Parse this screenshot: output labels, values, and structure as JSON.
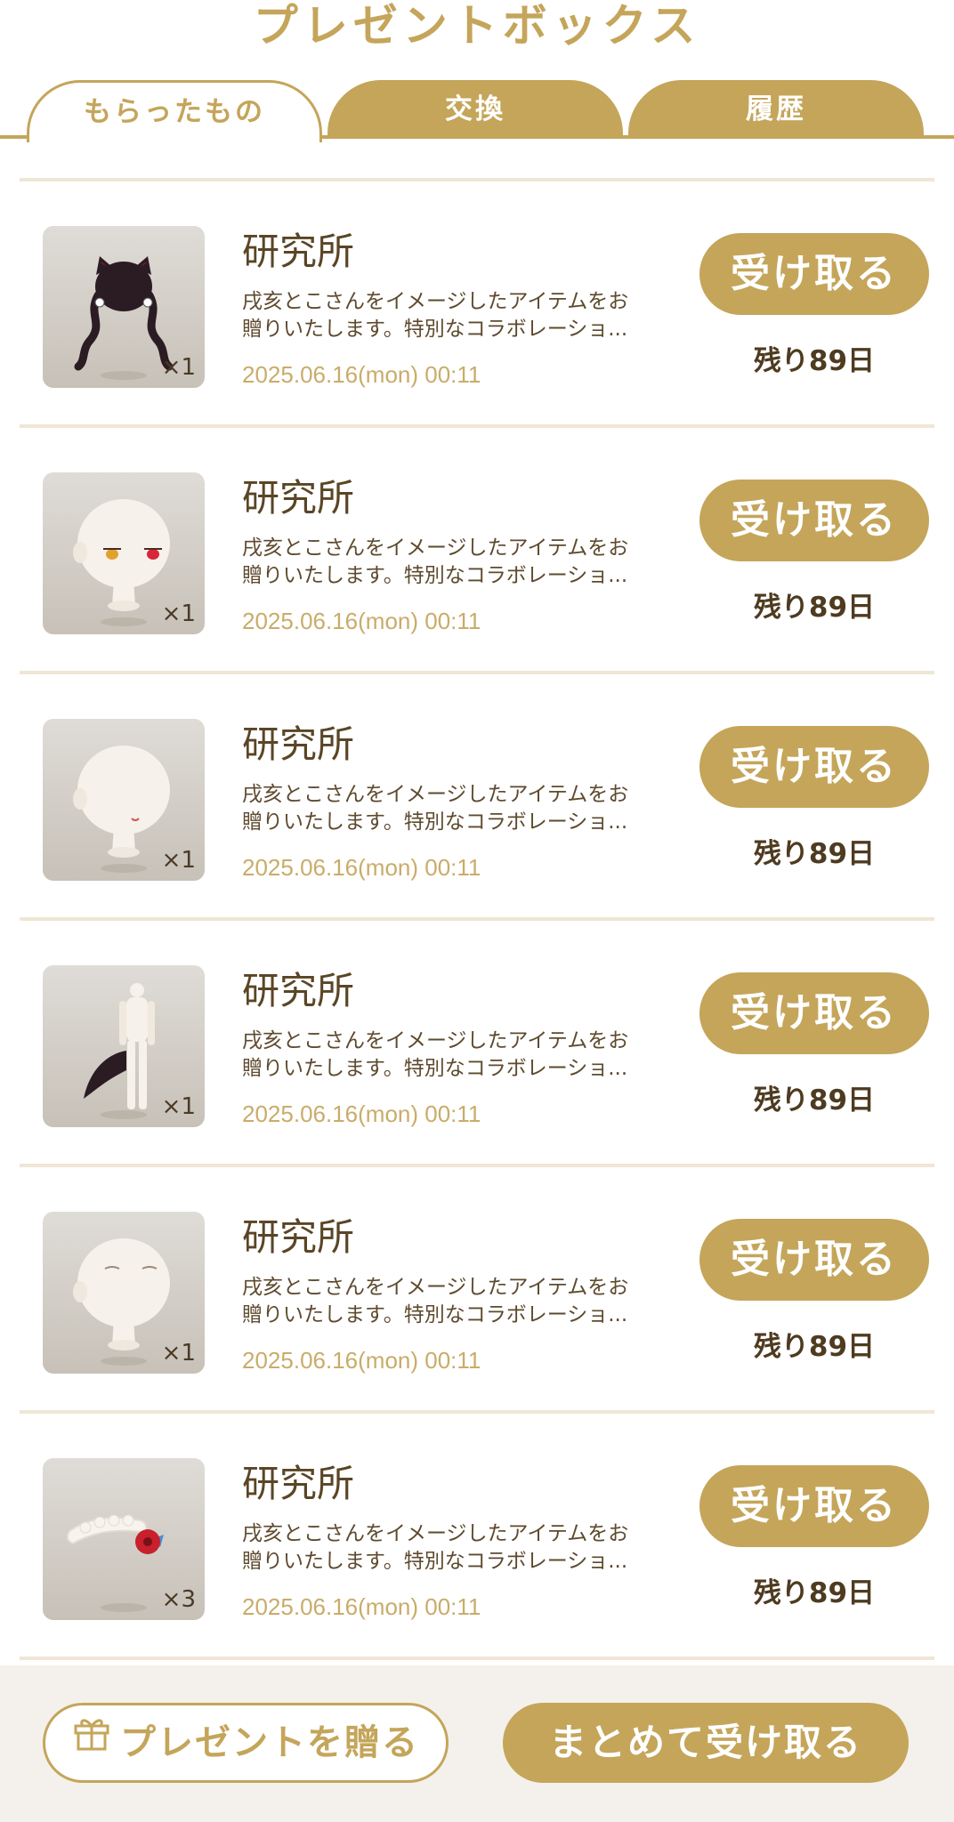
{
  "header": {
    "title": "プレゼントボックス"
  },
  "tabs": [
    {
      "label": "もらったもの",
      "active": true
    },
    {
      "label": "交換",
      "active": false
    },
    {
      "label": "履歴",
      "active": false
    }
  ],
  "items": [
    {
      "title": "研究所",
      "desc_line1": "戌亥とこさんをイメージしたアイテムをお",
      "desc_line2": "贈りいたします。特別なコラボレーショ...",
      "date": "2025.06.16(mon) 00:11",
      "quantity": "×1",
      "button": "受け取る",
      "remain": "残り89日",
      "icon": "hair-icon"
    },
    {
      "title": "研究所",
      "desc_line1": "戌亥とこさんをイメージしたアイテムをお",
      "desc_line2": "贈りいたします。特別なコラボレーショ...",
      "date": "2025.06.16(mon) 00:11",
      "quantity": "×1",
      "button": "受け取る",
      "remain": "残り89日",
      "icon": "eyes-icon"
    },
    {
      "title": "研究所",
      "desc_line1": "戌亥とこさんをイメージしたアイテムをお",
      "desc_line2": "贈りいたします。特別なコラボレーショ...",
      "date": "2025.06.16(mon) 00:11",
      "quantity": "×1",
      "button": "受け取る",
      "remain": "残り89日",
      "icon": "mouth-icon"
    },
    {
      "title": "研究所",
      "desc_line1": "戌亥とこさんをイメージしたアイテムをお",
      "desc_line2": "贈りいたします。特別なコラボレーショ...",
      "date": "2025.06.16(mon) 00:11",
      "quantity": "×1",
      "button": "受け取る",
      "remain": "残り89日",
      "icon": "tail-icon"
    },
    {
      "title": "研究所",
      "desc_line1": "戌亥とこさんをイメージしたアイテムをお",
      "desc_line2": "贈りいたします。特別なコラボレーショ...",
      "date": "2025.06.16(mon) 00:11",
      "quantity": "×1",
      "button": "受け取る",
      "remain": "残り89日",
      "icon": "closed-eyes-icon"
    },
    {
      "title": "研究所",
      "desc_line1": "戌亥とこさんをイメージしたアイテムをお",
      "desc_line2": "贈りいたします。特別なコラボレーショ...",
      "date": "2025.06.16(mon) 00:11",
      "quantity": "×3",
      "button": "受け取る",
      "remain": "残り89日",
      "icon": "hair-accessory-icon"
    }
  ],
  "footer": {
    "gift_label": "プレゼントを贈る",
    "bulk_label": "まとめて受け取る"
  },
  "colors": {
    "accent": "#c4a55a",
    "text": "#5a4525",
    "date": "#c9ac6a"
  }
}
